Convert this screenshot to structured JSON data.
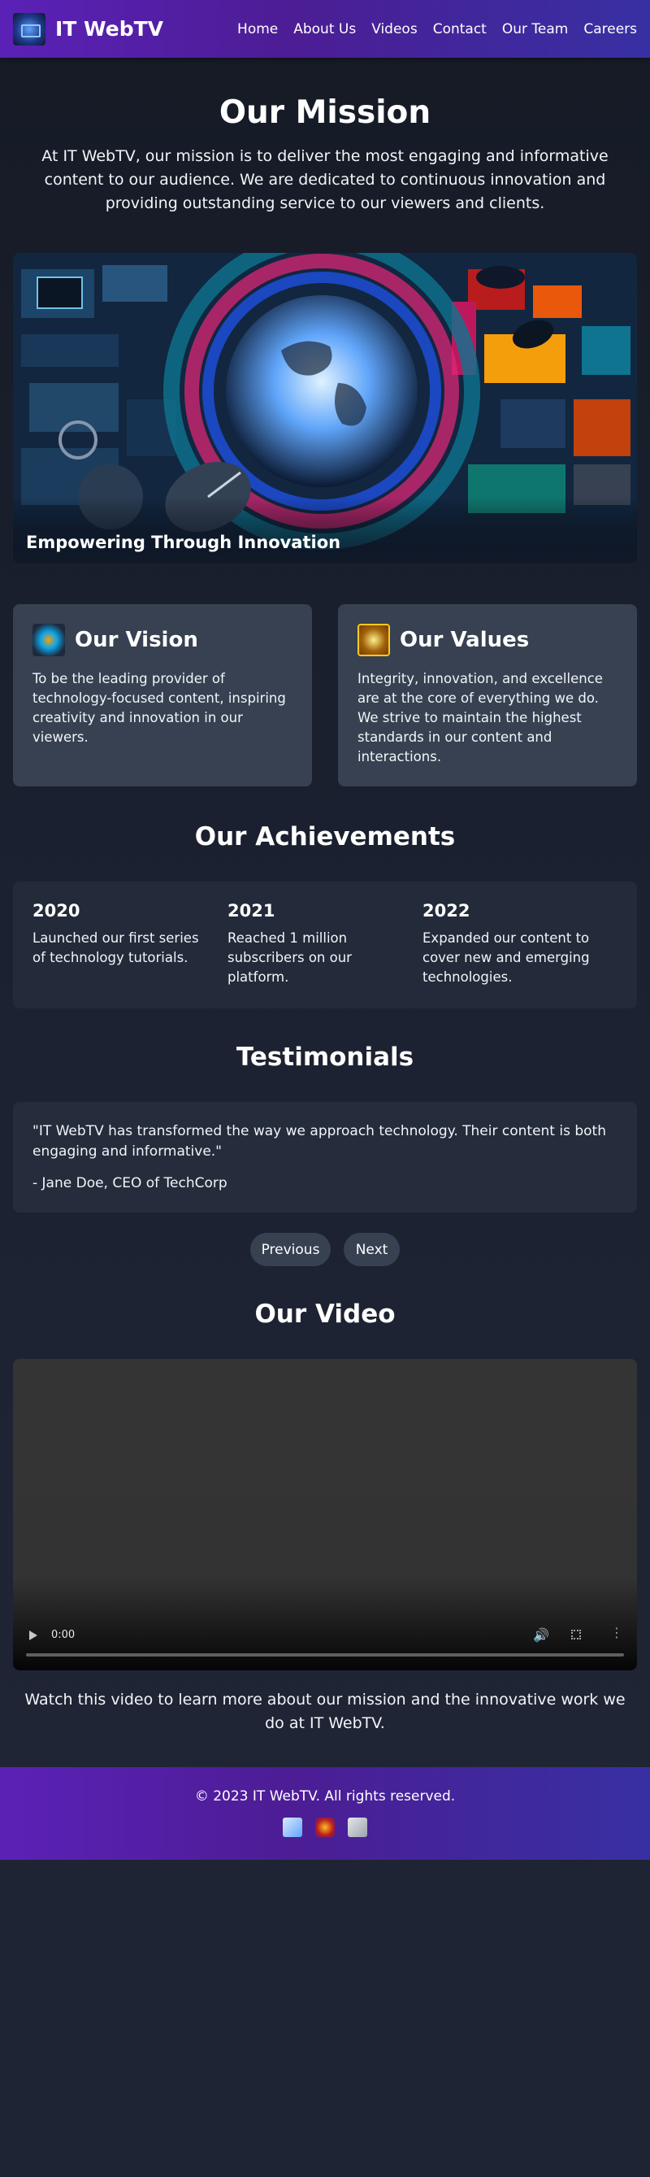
{
  "header": {
    "brand": "IT WebTV",
    "logo_icon": "satellite-logo-icon",
    "nav": [
      "Home",
      "About Us",
      "Videos",
      "Contact",
      "Our Team",
      "Careers"
    ]
  },
  "mission": {
    "title": "Our Mission",
    "text": "At IT WebTV, our mission is to deliver the most engaging and informative content to our audience. We are dedicated to continuous innovation and providing outstanding service to our viewers and clients."
  },
  "hero": {
    "caption": "Empowering Through Innovation"
  },
  "vision": {
    "title": "Our Vision",
    "text": "To be the leading provider of technology-focused content, inspiring creativity and innovation in our viewers."
  },
  "values": {
    "title": "Our Values",
    "text": "Integrity, innovation, and excellence are at the core of everything we do. We strive to maintain the highest standards in our content and interactions."
  },
  "achievements": {
    "title": "Our Achievements",
    "items": [
      {
        "year": "2020",
        "text": "Launched our first series of technology tutorials."
      },
      {
        "year": "2021",
        "text": "Reached 1 million subscribers on our platform."
      },
      {
        "year": "2022",
        "text": "Expanded our content to cover new and emerging technologies."
      }
    ]
  },
  "testimonials": {
    "title": "Testimonials",
    "quote": "\"IT WebTV has transformed the way we approach technology. Their content is both engaging and informative.\"",
    "author": "- Jane Doe, CEO of TechCorp",
    "prev_label": "Previous",
    "next_label": "Next"
  },
  "video": {
    "title": "Our Video",
    "time": "0:00",
    "caption": "Watch this video to learn more about our mission and the innovative work we do at IT WebTV."
  },
  "footer": {
    "copyright": "© 2023 IT WebTV. All rights reserved.",
    "social_icons": [
      "social-icon-1",
      "social-icon-2",
      "social-icon-3"
    ]
  },
  "colors": {
    "header_gradient_start": "#5b21b6",
    "header_gradient_end": "#3730a3",
    "page_bg": "#1e2433",
    "card_bg": "#374151"
  }
}
